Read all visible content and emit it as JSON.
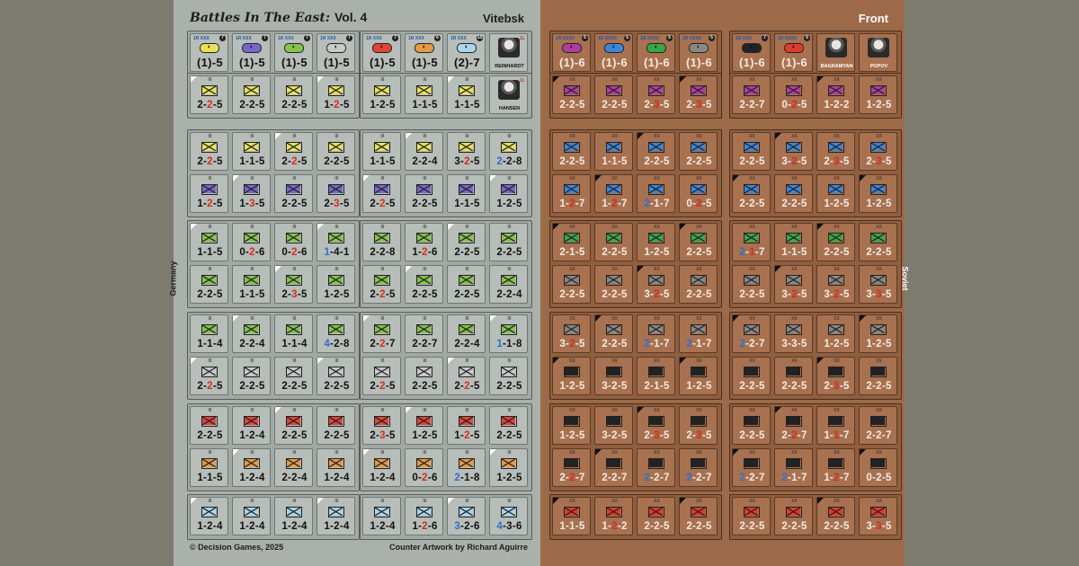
{
  "header": {
    "title": "Battles In The East:",
    "vol": "Vol. 4",
    "subtitle_left": "Vitebsk",
    "subtitle_right": "Front",
    "side_german": "Germany",
    "side_soviet": "Soviet",
    "footer_left": "© Decision Games, 2025",
    "footer_right": "Counter Artwork by Richard Aguirre"
  },
  "colors": {
    "german_bg": "#aab1ad",
    "soviet_bg": "#9c6a49",
    "red_factor": "#d62c22",
    "blue_factor": "#2e6fce"
  },
  "german_hq": [
    {
      "flag": "1R",
      "size": "XXX",
      "num": "7",
      "str": "(1)-5",
      "fill": "#e8e25a"
    },
    {
      "flag": "1R",
      "size": "XXX",
      "num": "7",
      "str": "(1)-5",
      "fill": "#7a66c9"
    },
    {
      "flag": "1R",
      "size": "XXX",
      "num": "7",
      "str": "(1)-5",
      "fill": "#86c34b"
    },
    {
      "flag": "1R",
      "size": "XXX",
      "num": "7",
      "str": "(1)-5",
      "fill": "#c9c9c9"
    },
    {
      "flag": "1R",
      "size": "XXX",
      "num": "7",
      "str": "(1)-5",
      "fill": "#e0453a"
    },
    {
      "flag": "1R",
      "size": "XXX",
      "num": "6",
      "str": "(1)-5",
      "fill": "#e59a45"
    },
    {
      "flag": "1R",
      "size": "XXX",
      "num": "15",
      "str": "(2)-7",
      "fill": "#a9d6ec"
    }
  ],
  "german_leaders": [
    {
      "name": "REINHARDT",
      "rank": "1L"
    },
    {
      "name": "HANSEN",
      "rank": "1L"
    }
  ],
  "soviet_hq": [
    {
      "flag": "1R",
      "size": "XXXX",
      "num": "5",
      "str": "(1)-6",
      "fill": "#b23da0"
    },
    {
      "flag": "1R",
      "size": "XXXX",
      "num": "5",
      "str": "(1)-6",
      "fill": "#3d86d8"
    },
    {
      "flag": "1R",
      "size": "XXXX",
      "num": "5",
      "str": "(1)-6",
      "fill": "#3aa74a"
    },
    {
      "flag": "1R",
      "size": "XXXX",
      "num": "5",
      "str": "(1)-6",
      "fill": "#888888"
    },
    {
      "flag": "1R",
      "size": "XXX",
      "num": "7",
      "str": "(1)-6",
      "fill": "#222222"
    },
    {
      "flag": "1R",
      "size": "XXXX",
      "num": "5",
      "str": "(1)-6",
      "fill": "#e03c2c"
    }
  ],
  "soviet_leaders": [
    {
      "name": "BAGRAMYAN",
      "rank": ""
    },
    {
      "name": "POPOV",
      "rank": ""
    }
  ],
  "german_rows": [
    [
      "2-2-5",
      "2-2-5",
      "2-2-5",
      "1-2-5",
      "1-2-5",
      "1-1-5",
      "1-1-5"
    ],
    [
      "2-2-5",
      "1-1-5",
      "2-2-5",
      "2-2-5",
      "1-1-5",
      "2-2-4",
      "3-2-5",
      "2-2-8"
    ],
    [
      "1-2-5",
      "1-3-5",
      "2-2-5",
      "2-3-5",
      "2-2-5",
      "2-2-5",
      "1-1-5",
      "1-2-5"
    ],
    [
      "1-1-5",
      "0-2-6",
      "0-2-6",
      "1-4-1",
      "2-2-8",
      "1-2-6",
      "2-2-5",
      "2-2-5"
    ],
    [
      "2-2-5",
      "1-1-5",
      "2-3-5",
      "1-2-5",
      "2-2-5",
      "2-2-5",
      "2-2-5",
      "2-2-4"
    ],
    [
      "1-1-4",
      "2-2-4",
      "1-1-4",
      "4-2-8",
      "2-2-7",
      "2-2-7",
      "2-2-4",
      "1-1-8"
    ],
    [
      "2-2-5",
      "2-2-5",
      "2-2-5",
      "2-2-5",
      "2-2-5",
      "2-2-5",
      "2-2-5",
      "2-2-5"
    ],
    [
      "2-2-5",
      "1-2-4",
      "2-2-5",
      "2-2-5",
      "2-3-5",
      "1-2-5",
      "1-2-5",
      "2-2-5"
    ],
    [
      "1-1-5",
      "1-2-4",
      "2-2-4",
      "1-2-4",
      "1-2-4",
      "0-2-6",
      "2-1-8",
      "1-2-5"
    ],
    [
      "1-2-4",
      "1-2-4",
      "1-2-4",
      "1-2-4",
      "1-2-4",
      "1-2-6",
      "3-2-6",
      "4-3-6"
    ]
  ],
  "soviet_rows": [
    [
      "2-2-5",
      "2-2-5",
      "2-3-5",
      "2-3-5",
      "2-2-7",
      "0-2-5",
      "1-2-2",
      "1-2-5"
    ],
    [
      "2-2-5",
      "1-1-5",
      "2-2-5",
      "2-2-5",
      "2-2-5",
      "3-2-5",
      "2-3-5",
      "2-3-5"
    ],
    [
      "1-2-7",
      "1-2-7",
      "2-1-7",
      "0-2-5",
      "2-2-5",
      "2-2-5",
      "1-2-5",
      "1-2-5"
    ],
    [
      "2-1-5",
      "2-2-5",
      "1-2-5",
      "2-2-5",
      "2-1-7",
      "1-1-5",
      "2-2-5",
      "2-2-5"
    ],
    [
      "2-2-5",
      "2-2-5",
      "3-2-5",
      "2-2-5",
      "2-2-5",
      "3-2-5",
      "3-2-5",
      "3-3-5"
    ],
    [
      "3-2-5",
      "2-2-5",
      "2-1-7",
      "2-1-7",
      "2-2-7",
      "3-3-5",
      "1-2-5",
      "1-2-5"
    ],
    [
      "1-2-5",
      "3-2-5",
      "2-1-5",
      "1-2-5",
      "2-2-5",
      "2-2-5",
      "2-3-5",
      "2-2-5"
    ],
    [
      "1-2-5",
      "3-2-5",
      "2-3-5",
      "2-3-5",
      "2-2-5",
      "2-2-7",
      "1-1-7",
      "2-2-7"
    ],
    [
      "2-2-7",
      "2-2-7",
      "2-2-7",
      "2-2-7",
      "2-2-7",
      "2-1-7",
      "1-2-7",
      "0-2-5"
    ],
    [
      "1-1-5",
      "1-2-2",
      "2-2-5",
      "2-2-5",
      "2-2-5",
      "2-2-5",
      "2-2-5",
      "3-3-5"
    ]
  ],
  "german_fill_by_row": [
    "#e8e25a",
    "#e8e25a",
    "#7a66c9",
    "#86c34b",
    "#86c34b",
    "#86c34b",
    "#c9c9c9",
    "#e0453a",
    "#e59a45",
    "#a9d6ec"
  ],
  "soviet_fill_by_row": [
    "#b23da0",
    "#3d86d8",
    "#3d86d8",
    "#3aa74a",
    "#888888",
    "#888888",
    "#222222",
    "#222222",
    "#222222",
    "#e03c2c"
  ],
  "red_factor_cells": {
    "german": [
      "0:0",
      "0:3",
      "1:0",
      "1:2",
      "1:6",
      "2:0",
      "2:1",
      "2:3",
      "2:4",
      "3:1",
      "3:2",
      "3:5",
      "4:2",
      "4:4",
      "5:4",
      "6:0",
      "6:4",
      "6:6",
      "7:4",
      "7:6",
      "8:5",
      "9:5"
    ],
    "soviet": [
      "0:2",
      "0:3",
      "0:5",
      "1:5",
      "1:6",
      "1:7",
      "2:0",
      "2:1",
      "2:3",
      "3:4",
      "4:2",
      "4:5",
      "4:6",
      "4:7",
      "5:0",
      "6:6",
      "7:2",
      "7:3",
      "7:5",
      "7:6",
      "8:0",
      "8:6",
      "9:1",
      "9:7"
    ]
  },
  "blue_factor_cells": {
    "german": [
      "1:7",
      "3:3",
      "5:3",
      "5:7",
      "8:6",
      "9:6",
      "9:7"
    ],
    "soviet": [
      "2:2",
      "3:4",
      "5:2",
      "5:3",
      "5:4",
      "8:2",
      "8:3",
      "8:4",
      "8:5"
    ]
  }
}
